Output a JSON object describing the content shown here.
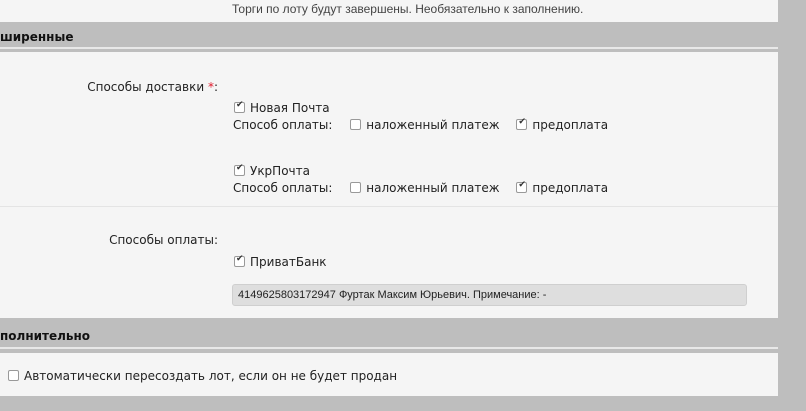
{
  "top_note": "Торги по лоту будут завершены. Необязательно к заполнению.",
  "section_extended": "ширенные",
  "delivery": {
    "label": "Способы доставки",
    "required_mark": "*",
    "colon": ":",
    "methods": [
      {
        "name": "Новая Почта",
        "checked": true,
        "payment_label": "Способ оплаты:",
        "cod": {
          "label": "наложенный платеж",
          "checked": false
        },
        "prepay": {
          "label": "предоплата",
          "checked": true
        }
      },
      {
        "name": "УкрПочта",
        "checked": true,
        "payment_label": "Способ оплаты:",
        "cod": {
          "label": "наложенный платеж",
          "checked": false
        },
        "prepay": {
          "label": "предоплата",
          "checked": true
        }
      }
    ]
  },
  "payment": {
    "label": "Способы оплаты:",
    "bank": {
      "name": "ПриватБанк",
      "checked": true
    },
    "details": "4149625803172947 Фуртак Максим Юрьевич. Примечание:  -"
  },
  "section_additional": "полнительно",
  "relist": {
    "label": "Автоматически пересоздать лот, если он не будет продан",
    "checked": false
  }
}
